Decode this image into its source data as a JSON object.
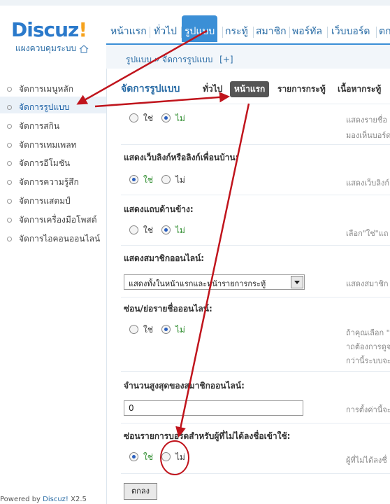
{
  "header": {
    "logo_text": "Discuz",
    "logo_mark": "!",
    "admin_cp_label": "แผงควบคุมระบบ",
    "nav": [
      "หน้าแรก",
      "ทั่วไป",
      "รูปแบบ",
      "กระทู้",
      "สมาชิก",
      "พอร์ทัล",
      "เว็บบอร์ด",
      "ตก"
    ],
    "active_nav": "รูปแบบ"
  },
  "breadcrumb": {
    "root": "รูปแบบ",
    "sep": "»",
    "current": "จัดการรูปแบบ",
    "add": "[+]"
  },
  "sidebar": {
    "items": [
      "จัดการเมนูหลัก",
      "จัดการรูปแบบ",
      "จัดการสกิน",
      "จัดการเทมเพลท",
      "จัดการอีโมชัน",
      "จัดการความรู้สึก",
      "จัดการแสตมป์",
      "จัดการเครื่องมือโพสต์",
      "จัดการไอคอนออนไลน์"
    ],
    "active_index": 1
  },
  "footer": {
    "prefix": "Powered by",
    "brand": "Discuz!",
    "version": "X2.5"
  },
  "main": {
    "title": "จัดการรูปแบบ",
    "tabs": [
      "ทั่วไป",
      "หน้าแรก",
      "รายการกระทู้",
      "เนื้อหากระทู้"
    ],
    "active_tab": "หน้าแรก",
    "yes_label": "ใช่",
    "no_label": "ไม่",
    "rows": [
      {
        "label": "",
        "selected": "no",
        "desc": "แสดงรายชื่อ",
        "desc2": "มองเห็นบอร์ด"
      },
      {
        "label": "แสดงเว็บลิงก์หรือลิงก์เพื่อนบ้าน:",
        "selected": "yes",
        "desc": "แสดงเว็บลิงก์"
      },
      {
        "label": "แสดงแถบด้านข้าง:",
        "selected": "no",
        "desc": "เลือก\"ใช่\"แถ"
      },
      {
        "label": "แสดงสมาชิกออนไลน์:",
        "select_value": "แสดงทั้งในหน้าแรกและหน้ารายการกระทู้",
        "desc": "แสดงสมาชิก"
      },
      {
        "label": "ซ่อน/ย่อรายชื่อออนไลน์:",
        "selected": "no",
        "desc": "ถ้าคุณเลือก \"",
        "desc2": "าถต้องการดูจ",
        "desc3": "กว่านี้ระบบจะ"
      },
      {
        "label": "จำนวนสูงสุดของสมาชิกออนไลน์:",
        "input_value": "0",
        "desc": "การตั้งค่านี้จะ"
      },
      {
        "label": "ซ่อนรายการบอร์ดสำหรับผู้ที่ไม่ได้ลงชื่อเข้าใช้:",
        "selected": "yes",
        "desc": "ผู้ที่ไม่ได้ลงชื่"
      }
    ],
    "submit_label": "ตกลง"
  },
  "annotation_color": "#c0141c"
}
